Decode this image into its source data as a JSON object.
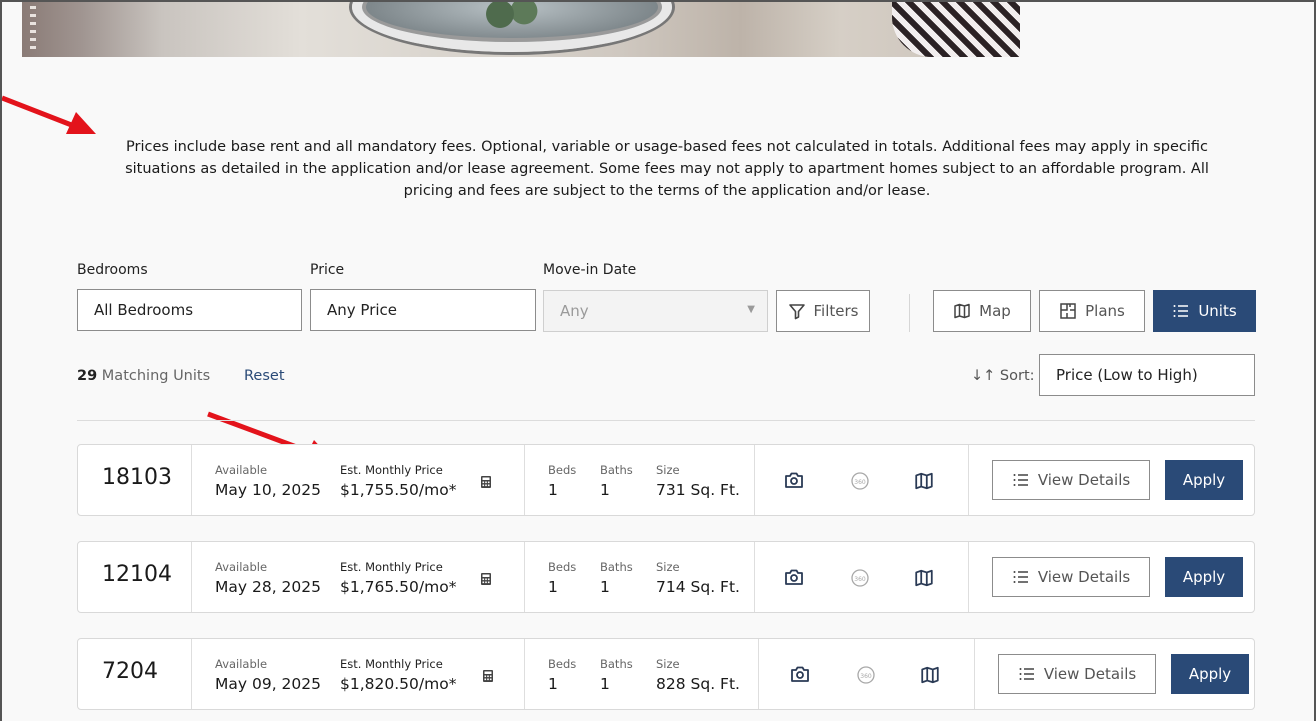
{
  "notice": "Prices include base rent and all mandatory fees. Optional, variable or usage-based fees not calculated in totals. Additional fees may apply in specific situations as detailed in the application and/or lease agreement. Some fees may not apply to apartment homes subject to an affordable program. All pricing and fees are subject to the terms of the application and/or lease.",
  "filters": {
    "bedrooms_label": "Bedrooms",
    "bedrooms_value": "All Bedrooms",
    "price_label": "Price",
    "price_value": "Any Price",
    "movein_label": "Move-in Date",
    "movein_placeholder": "Any",
    "filters_button": "Filters"
  },
  "views": {
    "map": "Map",
    "plans": "Plans",
    "units": "Units"
  },
  "results": {
    "count": "29",
    "count_label": "Matching Units",
    "reset": "Reset",
    "sort_label": "Sort:",
    "sort_value": "Price (Low to High)"
  },
  "card_labels": {
    "available": "Available",
    "price": "Est. Monthly Price",
    "beds": "Beds",
    "baths": "Baths",
    "size": "Size",
    "view_details": "View Details",
    "apply": "Apply"
  },
  "units": [
    {
      "unit": "18103",
      "available": "May 10, 2025",
      "price": "$1,755.50/mo*",
      "beds": "1",
      "baths": "1",
      "size": "731 Sq. Ft."
    },
    {
      "unit": "12104",
      "available": "May 28, 2025",
      "price": "$1,765.50/mo*",
      "beds": "1",
      "baths": "1",
      "size": "714 Sq. Ft."
    },
    {
      "unit": "7204",
      "available": "May 09, 2025",
      "price": "$1,820.50/mo*",
      "beds": "1",
      "baths": "1",
      "size": "828 Sq. Ft."
    }
  ],
  "colors": {
    "primary": "#2a4a77",
    "annotation_arrow": "#e3131b"
  },
  "icons": [
    "calculator-icon",
    "camera-icon",
    "tour-360-icon",
    "map-icon",
    "list-icon",
    "filter-icon",
    "floorplan-icon",
    "sort-icon"
  ]
}
